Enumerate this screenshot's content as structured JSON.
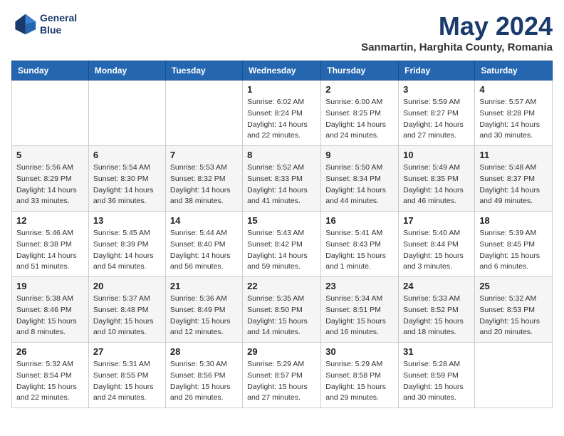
{
  "header": {
    "logo_line1": "General",
    "logo_line2": "Blue",
    "month": "May 2024",
    "location": "Sanmartin, Harghita County, Romania"
  },
  "weekdays": [
    "Sunday",
    "Monday",
    "Tuesday",
    "Wednesday",
    "Thursday",
    "Friday",
    "Saturday"
  ],
  "weeks": [
    [
      {
        "day": "",
        "info": ""
      },
      {
        "day": "",
        "info": ""
      },
      {
        "day": "",
        "info": ""
      },
      {
        "day": "1",
        "info": "Sunrise: 6:02 AM\nSunset: 8:24 PM\nDaylight: 14 hours\nand 22 minutes."
      },
      {
        "day": "2",
        "info": "Sunrise: 6:00 AM\nSunset: 8:25 PM\nDaylight: 14 hours\nand 24 minutes."
      },
      {
        "day": "3",
        "info": "Sunrise: 5:59 AM\nSunset: 8:27 PM\nDaylight: 14 hours\nand 27 minutes."
      },
      {
        "day": "4",
        "info": "Sunrise: 5:57 AM\nSunset: 8:28 PM\nDaylight: 14 hours\nand 30 minutes."
      }
    ],
    [
      {
        "day": "5",
        "info": "Sunrise: 5:56 AM\nSunset: 8:29 PM\nDaylight: 14 hours\nand 33 minutes."
      },
      {
        "day": "6",
        "info": "Sunrise: 5:54 AM\nSunset: 8:30 PM\nDaylight: 14 hours\nand 36 minutes."
      },
      {
        "day": "7",
        "info": "Sunrise: 5:53 AM\nSunset: 8:32 PM\nDaylight: 14 hours\nand 38 minutes."
      },
      {
        "day": "8",
        "info": "Sunrise: 5:52 AM\nSunset: 8:33 PM\nDaylight: 14 hours\nand 41 minutes."
      },
      {
        "day": "9",
        "info": "Sunrise: 5:50 AM\nSunset: 8:34 PM\nDaylight: 14 hours\nand 44 minutes."
      },
      {
        "day": "10",
        "info": "Sunrise: 5:49 AM\nSunset: 8:35 PM\nDaylight: 14 hours\nand 46 minutes."
      },
      {
        "day": "11",
        "info": "Sunrise: 5:48 AM\nSunset: 8:37 PM\nDaylight: 14 hours\nand 49 minutes."
      }
    ],
    [
      {
        "day": "12",
        "info": "Sunrise: 5:46 AM\nSunset: 8:38 PM\nDaylight: 14 hours\nand 51 minutes."
      },
      {
        "day": "13",
        "info": "Sunrise: 5:45 AM\nSunset: 8:39 PM\nDaylight: 14 hours\nand 54 minutes."
      },
      {
        "day": "14",
        "info": "Sunrise: 5:44 AM\nSunset: 8:40 PM\nDaylight: 14 hours\nand 56 minutes."
      },
      {
        "day": "15",
        "info": "Sunrise: 5:43 AM\nSunset: 8:42 PM\nDaylight: 14 hours\nand 59 minutes."
      },
      {
        "day": "16",
        "info": "Sunrise: 5:41 AM\nSunset: 8:43 PM\nDaylight: 15 hours\nand 1 minute."
      },
      {
        "day": "17",
        "info": "Sunrise: 5:40 AM\nSunset: 8:44 PM\nDaylight: 15 hours\nand 3 minutes."
      },
      {
        "day": "18",
        "info": "Sunrise: 5:39 AM\nSunset: 8:45 PM\nDaylight: 15 hours\nand 6 minutes."
      }
    ],
    [
      {
        "day": "19",
        "info": "Sunrise: 5:38 AM\nSunset: 8:46 PM\nDaylight: 15 hours\nand 8 minutes."
      },
      {
        "day": "20",
        "info": "Sunrise: 5:37 AM\nSunset: 8:48 PM\nDaylight: 15 hours\nand 10 minutes."
      },
      {
        "day": "21",
        "info": "Sunrise: 5:36 AM\nSunset: 8:49 PM\nDaylight: 15 hours\nand 12 minutes."
      },
      {
        "day": "22",
        "info": "Sunrise: 5:35 AM\nSunset: 8:50 PM\nDaylight: 15 hours\nand 14 minutes."
      },
      {
        "day": "23",
        "info": "Sunrise: 5:34 AM\nSunset: 8:51 PM\nDaylight: 15 hours\nand 16 minutes."
      },
      {
        "day": "24",
        "info": "Sunrise: 5:33 AM\nSunset: 8:52 PM\nDaylight: 15 hours\nand 18 minutes."
      },
      {
        "day": "25",
        "info": "Sunrise: 5:32 AM\nSunset: 8:53 PM\nDaylight: 15 hours\nand 20 minutes."
      }
    ],
    [
      {
        "day": "26",
        "info": "Sunrise: 5:32 AM\nSunset: 8:54 PM\nDaylight: 15 hours\nand 22 minutes."
      },
      {
        "day": "27",
        "info": "Sunrise: 5:31 AM\nSunset: 8:55 PM\nDaylight: 15 hours\nand 24 minutes."
      },
      {
        "day": "28",
        "info": "Sunrise: 5:30 AM\nSunset: 8:56 PM\nDaylight: 15 hours\nand 26 minutes."
      },
      {
        "day": "29",
        "info": "Sunrise: 5:29 AM\nSunset: 8:57 PM\nDaylight: 15 hours\nand 27 minutes."
      },
      {
        "day": "30",
        "info": "Sunrise: 5:29 AM\nSunset: 8:58 PM\nDaylight: 15 hours\nand 29 minutes."
      },
      {
        "day": "31",
        "info": "Sunrise: 5:28 AM\nSunset: 8:59 PM\nDaylight: 15 hours\nand 30 minutes."
      },
      {
        "day": "",
        "info": ""
      }
    ]
  ]
}
